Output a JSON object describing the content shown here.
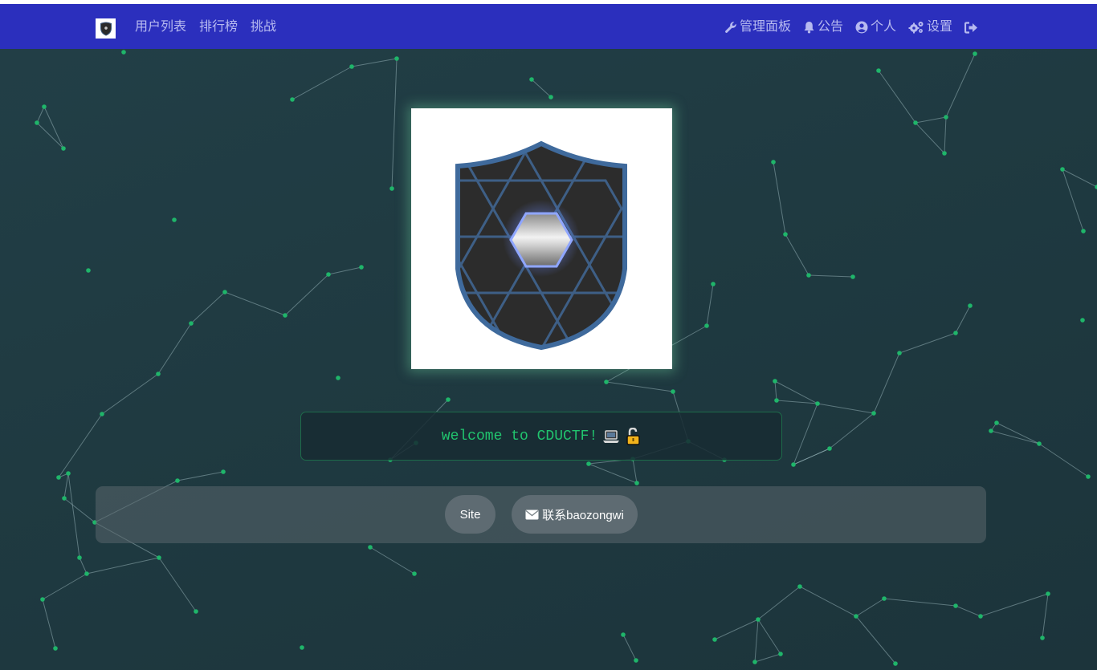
{
  "nav": {
    "brand_icon": "shield-logo-icon",
    "left_items": [
      {
        "label": "用户列表"
      },
      {
        "label": "排行榜"
      },
      {
        "label": "挑战"
      }
    ],
    "admin": {
      "label": "管理面板",
      "icon": "wrench-icon"
    },
    "notice": {
      "label": "公告",
      "icon": "bell-icon"
    },
    "profile": {
      "label": "个人",
      "icon": "user-circle-icon"
    },
    "settings": {
      "label": "设置",
      "icon": "cogs-icon"
    },
    "logout": {
      "icon": "sign-out-icon"
    }
  },
  "hero": {
    "logo_icon": "shield-hexagon-logo"
  },
  "welcome": {
    "text": "welcome to CDUCTF!",
    "icons": [
      "laptop-emoji",
      "unlocked-padlock-emoji"
    ]
  },
  "footer": {
    "site_label": "Site",
    "contact_label": "联系baozongwi",
    "contact_icon": "envelope-icon"
  },
  "colors": {
    "navbar": "#2b2fbd",
    "nav_text": "#b7baf0",
    "background": "#203b42",
    "accent_green": "#21c46e",
    "node": "#1fb56a"
  }
}
